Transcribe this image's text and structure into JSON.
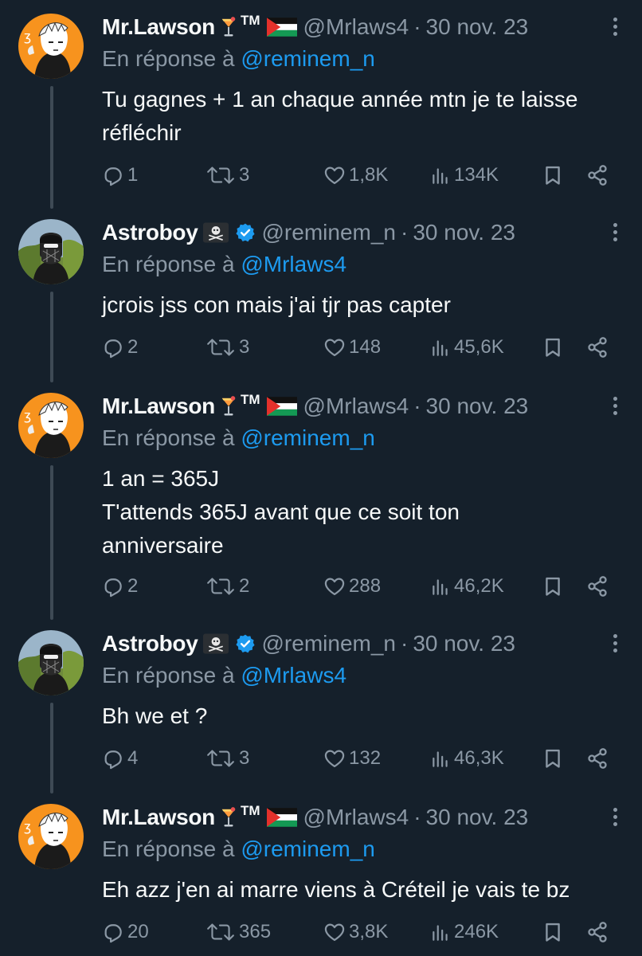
{
  "colors": {
    "background": "#15202b",
    "text": "#f7f9f9",
    "muted": "#8b98a5",
    "link": "#1d9bf0",
    "thread_line": "#3e4a55",
    "verified": "#1d9bf0"
  },
  "tweets": [
    {
      "author": "Mr.Lawson",
      "author_suffix": "TM",
      "handle": "@Mrlaws4",
      "date": "30 nov. 23",
      "reply_prefix": "En réponse à",
      "reply_to": "@reminem_n",
      "lines": [
        "Tu gagnes + 1 an chaque année mtn je te laisse",
        "réfléchir"
      ],
      "replies": "1",
      "retweets": "3",
      "likes": "1,8K",
      "views": "134K"
    },
    {
      "author": "Astroboy",
      "handle": "@reminem_n",
      "date": "30 nov. 23",
      "reply_prefix": "En réponse à",
      "reply_to": "@Mrlaws4",
      "lines": [
        "jcrois jss con mais j'ai tjr pas capter"
      ],
      "replies": "2",
      "retweets": "3",
      "likes": "148",
      "views": "45,6K"
    },
    {
      "author": "Mr.Lawson",
      "author_suffix": "TM",
      "handle": "@Mrlaws4",
      "date": "30 nov. 23",
      "reply_prefix": "En réponse à",
      "reply_to": "@reminem_n",
      "lines": [
        "1 an = 365J",
        "T'attends 365J avant que ce soit ton",
        "anniversaire"
      ],
      "replies": "2",
      "retweets": "2",
      "likes": "288",
      "views": "46,2K"
    },
    {
      "author": "Astroboy",
      "handle": "@reminem_n",
      "date": "30 nov. 23",
      "reply_prefix": "En réponse à",
      "reply_to": "@Mrlaws4",
      "lines": [
        "Bh we et ?"
      ],
      "replies": "4",
      "retweets": "3",
      "likes": "132",
      "views": "46,3K"
    },
    {
      "author": "Mr.Lawson",
      "author_suffix": "TM",
      "handle": "@Mrlaws4",
      "date": "30 nov. 23",
      "reply_prefix": "En réponse à",
      "reply_to": "@reminem_n",
      "lines": [
        "Eh azz j'en ai marre viens à Créteil je vais te bz"
      ],
      "replies": "20",
      "retweets": "365",
      "likes": "3,8K",
      "views": "246K"
    }
  ]
}
